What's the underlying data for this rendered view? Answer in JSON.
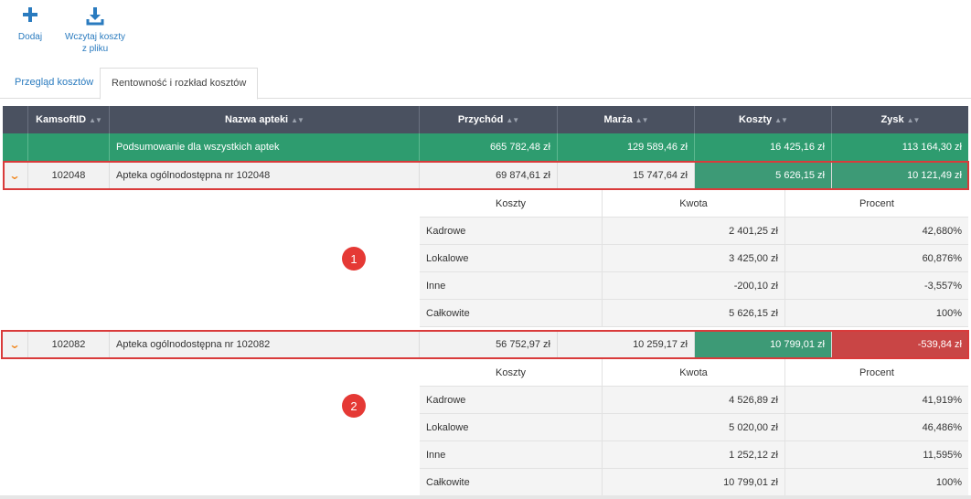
{
  "toolbar": {
    "add_label": "Dodaj",
    "load_label": "Wczytaj koszty z pliku"
  },
  "tabs": [
    {
      "label": "Przegląd kosztów"
    },
    {
      "label": "Rentowność i rozkład kosztów"
    }
  ],
  "table": {
    "headers": [
      "KamsoftID",
      "Nazwa apteki",
      "Przychód",
      "Marża",
      "Koszty",
      "Zysk"
    ],
    "summary": {
      "name": "Podsumowanie dla wszystkich aptek",
      "przychod": "665 782,48 zł",
      "marza": "129 589,46 zł",
      "koszty": "16 425,16 zł",
      "zysk": "113 164,30 zł"
    },
    "rows": [
      {
        "id": "102048",
        "name": "Apteka ogólnodostępna nr 102048",
        "przychod": "69 874,61 zł",
        "marza": "15 747,64 zł",
        "koszty": "5 626,15 zł",
        "zysk": "10 121,49 zł",
        "costs": [
          {
            "label": "Kadrowe",
            "kwota": "2 401,25 zł",
            "procent": "42,680%"
          },
          {
            "label": "Lokalowe",
            "kwota": "3 425,00 zł",
            "procent": "60,876%"
          },
          {
            "label": "Inne",
            "kwota": "-200,10 zł",
            "procent": "-3,557%"
          },
          {
            "label": "Całkowite",
            "kwota": "5 626,15 zł",
            "procent": "100%"
          }
        ]
      },
      {
        "id": "102082",
        "name": "Apteka ogólnodostępna nr 102082",
        "przychod": "56 752,97 zł",
        "marza": "10 259,17 zł",
        "koszty": "10 799,01 zł",
        "zysk": "-539,84 zł",
        "costs": [
          {
            "label": "Kadrowe",
            "kwota": "4 526,89 zł",
            "procent": "41,919%"
          },
          {
            "label": "Lokalowe",
            "kwota": "5 020,00 zł",
            "procent": "46,486%"
          },
          {
            "label": "Inne",
            "kwota": "1 252,12 zł",
            "procent": "11,595%"
          },
          {
            "label": "Całkowite",
            "kwota": "10 799,01 zł",
            "procent": "100%"
          }
        ]
      }
    ],
    "sub_headers": [
      "Koszty",
      "Kwota",
      "Procent"
    ]
  },
  "badges": [
    "1",
    "2"
  ],
  "colors": {
    "header_bg": "#4a5160",
    "summary_green": "#2e9c6f",
    "positive_green": "#3d9a76",
    "negative_red": "#c94545",
    "accent_blue": "#2a7bbf",
    "chevron_orange": "#f08a24",
    "highlight_red": "#d93b3b"
  },
  "icons": {
    "add": "plus-icon",
    "load": "download-icon",
    "expand": "chevron-down-icon"
  }
}
